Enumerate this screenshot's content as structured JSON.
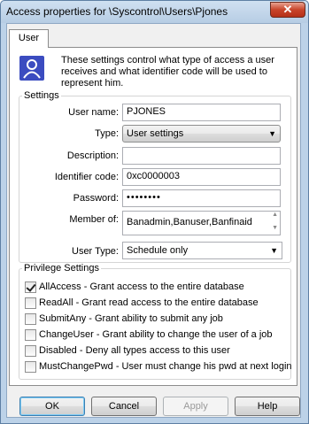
{
  "window": {
    "title": "Access properties for \\Syscontrol\\Users\\Pjones",
    "close_glyph": "✕"
  },
  "tabs": [
    {
      "label": "User"
    }
  ],
  "description": "These settings control what type of access a user receives and what identifier code will be used to represent him.",
  "settings": {
    "group_label": "Settings",
    "user_name": {
      "label": "User name:",
      "value": "PJONES"
    },
    "type": {
      "label": "Type:",
      "value": "User settings"
    },
    "description": {
      "label": "Description:",
      "value": ""
    },
    "identifier": {
      "label": "Identifier code:",
      "value": "0xc0000003"
    },
    "password": {
      "label": "Password:",
      "value": "••••••••"
    },
    "member_of": {
      "label": "Member of:",
      "value": "Banadmin,Banuser,Banfinaid"
    },
    "user_type": {
      "label": "User Type:",
      "value": "Schedule only"
    }
  },
  "privileges": {
    "group_label": "Privilege Settings",
    "items": [
      {
        "label": "AllAccess - Grant access to the entire database",
        "checked": true
      },
      {
        "label": "ReadAll - Grant read access to the entire database",
        "checked": false
      },
      {
        "label": "SubmitAny - Grant ability to submit any job",
        "checked": false
      },
      {
        "label": "ChangeUser - Grant ability to change the user of a job",
        "checked": false
      },
      {
        "label": "Disabled - Deny all types access to this user",
        "checked": false
      },
      {
        "label": "MustChangePwd - User must change his pwd at next login",
        "checked": false
      }
    ]
  },
  "buttons": {
    "ok": "OK",
    "cancel": "Cancel",
    "apply": "Apply",
    "help": "Help"
  },
  "icons": {
    "user": "user-icon",
    "dropdown": "chevron-down-icon",
    "close": "close-icon"
  },
  "colors": {
    "title_bar": "#bcd2e8",
    "close_button": "#c8442a",
    "user_icon": "#3b4cc0"
  }
}
